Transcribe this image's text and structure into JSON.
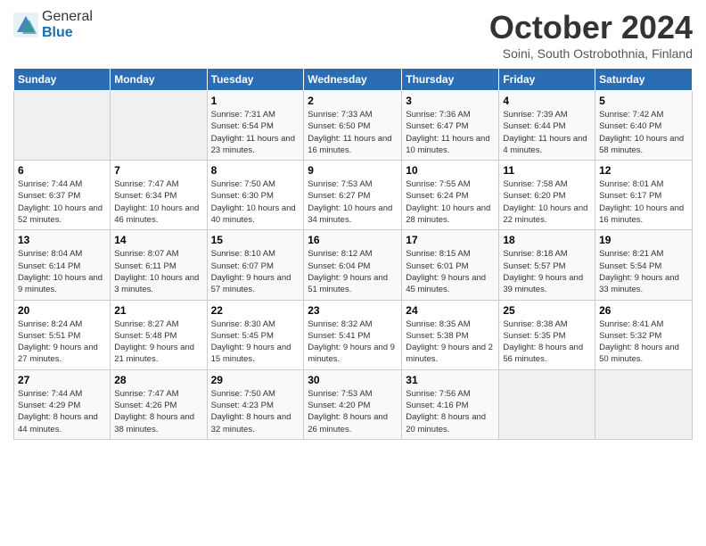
{
  "header": {
    "logo_general": "General",
    "logo_blue": "Blue",
    "title": "October 2024",
    "location": "Soini, South Ostrobothnia, Finland"
  },
  "days_of_week": [
    "Sunday",
    "Monday",
    "Tuesday",
    "Wednesday",
    "Thursday",
    "Friday",
    "Saturday"
  ],
  "weeks": [
    [
      {
        "day": "",
        "text": ""
      },
      {
        "day": "",
        "text": ""
      },
      {
        "day": "1",
        "text": "Sunrise: 7:31 AM\nSunset: 6:54 PM\nDaylight: 11 hours and 23 minutes."
      },
      {
        "day": "2",
        "text": "Sunrise: 7:33 AM\nSunset: 6:50 PM\nDaylight: 11 hours and 16 minutes."
      },
      {
        "day": "3",
        "text": "Sunrise: 7:36 AM\nSunset: 6:47 PM\nDaylight: 11 hours and 10 minutes."
      },
      {
        "day": "4",
        "text": "Sunrise: 7:39 AM\nSunset: 6:44 PM\nDaylight: 11 hours and 4 minutes."
      },
      {
        "day": "5",
        "text": "Sunrise: 7:42 AM\nSunset: 6:40 PM\nDaylight: 10 hours and 58 minutes."
      }
    ],
    [
      {
        "day": "6",
        "text": "Sunrise: 7:44 AM\nSunset: 6:37 PM\nDaylight: 10 hours and 52 minutes."
      },
      {
        "day": "7",
        "text": "Sunrise: 7:47 AM\nSunset: 6:34 PM\nDaylight: 10 hours and 46 minutes."
      },
      {
        "day": "8",
        "text": "Sunrise: 7:50 AM\nSunset: 6:30 PM\nDaylight: 10 hours and 40 minutes."
      },
      {
        "day": "9",
        "text": "Sunrise: 7:53 AM\nSunset: 6:27 PM\nDaylight: 10 hours and 34 minutes."
      },
      {
        "day": "10",
        "text": "Sunrise: 7:55 AM\nSunset: 6:24 PM\nDaylight: 10 hours and 28 minutes."
      },
      {
        "day": "11",
        "text": "Sunrise: 7:58 AM\nSunset: 6:20 PM\nDaylight: 10 hours and 22 minutes."
      },
      {
        "day": "12",
        "text": "Sunrise: 8:01 AM\nSunset: 6:17 PM\nDaylight: 10 hours and 16 minutes."
      }
    ],
    [
      {
        "day": "13",
        "text": "Sunrise: 8:04 AM\nSunset: 6:14 PM\nDaylight: 10 hours and 9 minutes."
      },
      {
        "day": "14",
        "text": "Sunrise: 8:07 AM\nSunset: 6:11 PM\nDaylight: 10 hours and 3 minutes."
      },
      {
        "day": "15",
        "text": "Sunrise: 8:10 AM\nSunset: 6:07 PM\nDaylight: 9 hours and 57 minutes."
      },
      {
        "day": "16",
        "text": "Sunrise: 8:12 AM\nSunset: 6:04 PM\nDaylight: 9 hours and 51 minutes."
      },
      {
        "day": "17",
        "text": "Sunrise: 8:15 AM\nSunset: 6:01 PM\nDaylight: 9 hours and 45 minutes."
      },
      {
        "day": "18",
        "text": "Sunrise: 8:18 AM\nSunset: 5:57 PM\nDaylight: 9 hours and 39 minutes."
      },
      {
        "day": "19",
        "text": "Sunrise: 8:21 AM\nSunset: 5:54 PM\nDaylight: 9 hours and 33 minutes."
      }
    ],
    [
      {
        "day": "20",
        "text": "Sunrise: 8:24 AM\nSunset: 5:51 PM\nDaylight: 9 hours and 27 minutes."
      },
      {
        "day": "21",
        "text": "Sunrise: 8:27 AM\nSunset: 5:48 PM\nDaylight: 9 hours and 21 minutes."
      },
      {
        "day": "22",
        "text": "Sunrise: 8:30 AM\nSunset: 5:45 PM\nDaylight: 9 hours and 15 minutes."
      },
      {
        "day": "23",
        "text": "Sunrise: 8:32 AM\nSunset: 5:41 PM\nDaylight: 9 hours and 9 minutes."
      },
      {
        "day": "24",
        "text": "Sunrise: 8:35 AM\nSunset: 5:38 PM\nDaylight: 9 hours and 2 minutes."
      },
      {
        "day": "25",
        "text": "Sunrise: 8:38 AM\nSunset: 5:35 PM\nDaylight: 8 hours and 56 minutes."
      },
      {
        "day": "26",
        "text": "Sunrise: 8:41 AM\nSunset: 5:32 PM\nDaylight: 8 hours and 50 minutes."
      }
    ],
    [
      {
        "day": "27",
        "text": "Sunrise: 7:44 AM\nSunset: 4:29 PM\nDaylight: 8 hours and 44 minutes."
      },
      {
        "day": "28",
        "text": "Sunrise: 7:47 AM\nSunset: 4:26 PM\nDaylight: 8 hours and 38 minutes."
      },
      {
        "day": "29",
        "text": "Sunrise: 7:50 AM\nSunset: 4:23 PM\nDaylight: 8 hours and 32 minutes."
      },
      {
        "day": "30",
        "text": "Sunrise: 7:53 AM\nSunset: 4:20 PM\nDaylight: 8 hours and 26 minutes."
      },
      {
        "day": "31",
        "text": "Sunrise: 7:56 AM\nSunset: 4:16 PM\nDaylight: 8 hours and 20 minutes."
      },
      {
        "day": "",
        "text": ""
      },
      {
        "day": "",
        "text": ""
      }
    ]
  ]
}
